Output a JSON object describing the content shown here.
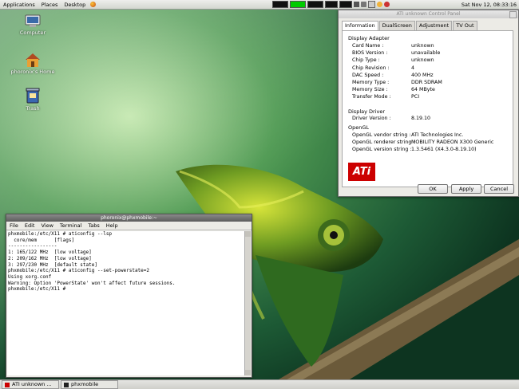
{
  "top_panel": {
    "menus": [
      "Applications",
      "Places",
      "Desktop"
    ],
    "clock": "Sat Nov 12, 08:33:16"
  },
  "desktop_icons": [
    {
      "label": "Computer",
      "icon": "computer-icon"
    },
    {
      "label": "phoronix's Home",
      "icon": "home-folder-icon"
    },
    {
      "label": "Trash",
      "icon": "trash-icon"
    }
  ],
  "ati_dialog": {
    "title": "ATI unknown Control Panel",
    "tabs": [
      "Information",
      "DualScreen",
      "Adjustment",
      "TV Out"
    ],
    "active_tab": "Information",
    "sections": {
      "display_adapter": "Display Adapter",
      "display_driver": "Display Driver",
      "opengl": "OpenGL"
    },
    "adapter_rows": [
      {
        "key": "Card Name :",
        "value": "unknown"
      },
      {
        "key": "BIOS Version :",
        "value": "unavailable"
      },
      {
        "key": "Chip Type :",
        "value": "unknown"
      },
      {
        "key": "Chip Revision :",
        "value": "4"
      },
      {
        "key": "DAC Speed :",
        "value": "400 MHz"
      },
      {
        "key": "Memory Type :",
        "value": "DDR SDRAM"
      },
      {
        "key": "Memory Size :",
        "value": "64 MByte"
      },
      {
        "key": "Transfer Mode :",
        "value": "PCI"
      }
    ],
    "driver_rows": [
      {
        "key": "Driver Version :",
        "value": "8.19.10"
      }
    ],
    "opengl_rows": [
      {
        "key": "OpenGL vendor string :",
        "value": "ATI Technologies Inc."
      },
      {
        "key": "OpenGL renderer string :",
        "value": "MOBILITY RADEON X300 Generic"
      },
      {
        "key": "OpenGL version string :",
        "value": "1.3.5461 (X4.3.0-8.19.10)"
      }
    ],
    "logo_text": "ATi",
    "buttons": {
      "ok": "OK",
      "apply": "Apply",
      "cancel": "Cancel"
    }
  },
  "terminal": {
    "title": "phoronix@phxmobile:~",
    "menu": [
      "File",
      "Edit",
      "View",
      "Terminal",
      "Tabs",
      "Help"
    ],
    "lines": [
      "phxmobile:/etc/X11 # aticonfig --lsp",
      "  core/mem      [flags]",
      "-----------------",
      "1: 165/122 MHz  [low voltage]",
      "2: 209/162 MHz  [low voltage]",
      "3: 297/230 MHz  [default state]",
      "phxmobile:/etc/X11 # aticonfig --set-powerstate=2",
      "Using xorg.conf",
      "Warning: Option 'PowerState' won't affect future sessions.",
      "phxmobile:/etc/X11 # "
    ]
  },
  "taskbar": {
    "tasks": [
      {
        "label": "ATI unknown ...",
        "icon": "ati-window-icon"
      },
      {
        "label": "phxmobile",
        "icon": "terminal-window-icon"
      }
    ]
  }
}
